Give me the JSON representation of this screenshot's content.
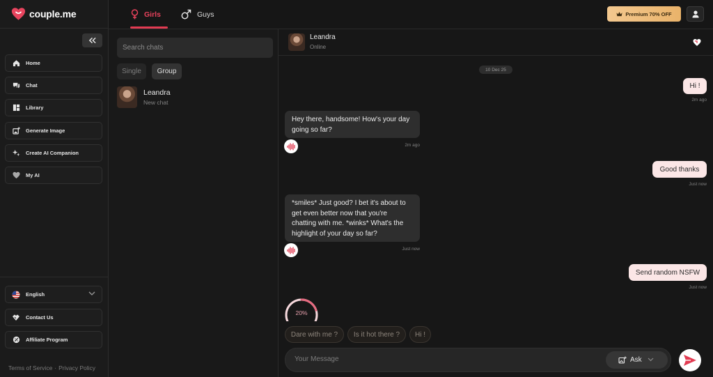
{
  "brand": {
    "name": "couple.me"
  },
  "sidebar": {
    "items": [
      {
        "label": "Home",
        "icon": "home-icon"
      },
      {
        "label": "Chat",
        "icon": "chat-icon"
      },
      {
        "label": "Library",
        "icon": "library-icon"
      },
      {
        "label": "Generate Image",
        "icon": "generate-image-icon"
      },
      {
        "label": "Create AI Companion",
        "icon": "sparkle-icon"
      },
      {
        "label": "My AI",
        "icon": "heart-icon"
      }
    ],
    "bottom_items": [
      {
        "label": "English",
        "icon": "us-flag-icon"
      },
      {
        "label": "Contact Us",
        "icon": "handshake-icon"
      },
      {
        "label": "Affiliate Program",
        "icon": "affiliate-icon"
      }
    ],
    "footer": {
      "terms": "Terms of Service",
      "separator": "·",
      "privacy": "Privacy Policy"
    }
  },
  "topbar": {
    "tabs": [
      {
        "label": "Girls",
        "icon": "female-icon"
      },
      {
        "label": "Guys",
        "icon": "male-icon"
      }
    ],
    "premium_label": "Premium 70% OFF"
  },
  "chat_list": {
    "search_placeholder": "Search chats",
    "filters": [
      "Single",
      "Group"
    ],
    "contacts": [
      {
        "name": "Leandra",
        "subtitle": "New chat"
      }
    ]
  },
  "conversation": {
    "contact_name": "Leandra",
    "status": "Online",
    "date": "10 Dec 25",
    "messages": [
      {
        "from": "user",
        "text": "Hi !",
        "time": "2m ago"
      },
      {
        "from": "ai",
        "lines": [
          "Hey there, handsome! How's your day",
          "going so far?"
        ],
        "time": "2m ago"
      },
      {
        "from": "user",
        "text": "Good thanks",
        "time": "Just now"
      },
      {
        "from": "ai",
        "lines": [
          "*smiles* Just good? I bet it's about to",
          "get even better now that you're",
          "chatting with me. *winks* What's the",
          "highlight of your day so far?"
        ],
        "time": "Just now"
      },
      {
        "from": "user",
        "text": "Send random NSFW",
        "time": "Just now"
      }
    ],
    "progress": {
      "value": 20,
      "label": "20%"
    },
    "suggestions": [
      "Dare with me ?",
      "Is it hot there ?",
      "Hi !"
    ],
    "composer": {
      "placeholder": "Your Message",
      "ask_label": "Ask"
    }
  },
  "colors": {
    "accent": "#e23b52",
    "user_bubble": "#fbe6e6",
    "ai_bubble": "#2e2e2e",
    "premium": "#eab36a"
  }
}
